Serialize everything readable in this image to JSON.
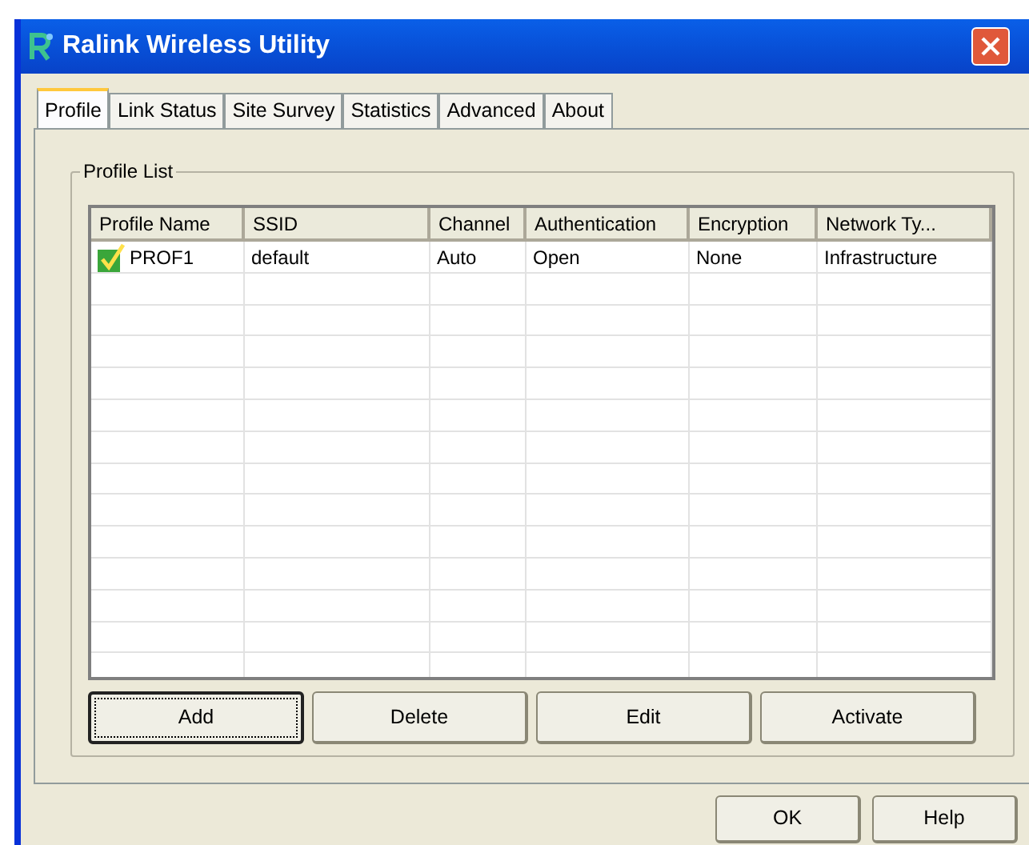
{
  "window": {
    "title": "Ralink Wireless Utility"
  },
  "tabs": [
    {
      "label": "Profile",
      "selected": true
    },
    {
      "label": "Link Status",
      "selected": false
    },
    {
      "label": "Site Survey",
      "selected": false
    },
    {
      "label": "Statistics",
      "selected": false
    },
    {
      "label": "Advanced",
      "selected": false
    },
    {
      "label": "About",
      "selected": false
    }
  ],
  "profile_list": {
    "title": "Profile List",
    "columns": [
      "Profile Name",
      "SSID",
      "Channel",
      "Authentication",
      "Encryption",
      "Network Ty..."
    ],
    "rows": [
      {
        "active": true,
        "cells": [
          "PROF1",
          "default",
          "Auto",
          "Open",
          "None",
          "Infrastructure"
        ]
      }
    ],
    "buttons": [
      {
        "label": "Add",
        "focused": true
      },
      {
        "label": "Delete",
        "focused": false
      },
      {
        "label": "Edit",
        "focused": false
      },
      {
        "label": "Activate",
        "focused": false
      }
    ]
  },
  "footer_buttons": [
    "OK",
    "Help"
  ]
}
